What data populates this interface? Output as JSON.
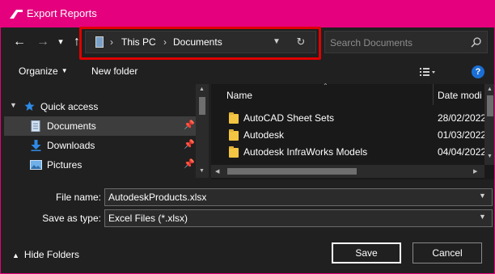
{
  "window": {
    "title": "Export Reports"
  },
  "nav": {
    "back": "←",
    "forward": "→",
    "recent": "▾",
    "up": "↑"
  },
  "address": {
    "crumbs": [
      "This PC",
      "Documents"
    ],
    "separator": "›"
  },
  "search": {
    "placeholder": "Search Documents"
  },
  "toolbar": {
    "organize": "Organize",
    "new_folder": "New folder"
  },
  "sidebar": {
    "items": [
      {
        "label": "Quick access",
        "icon": "star-icon"
      },
      {
        "label": "Documents",
        "icon": "document-icon",
        "pinned": true,
        "selected": true
      },
      {
        "label": "Downloads",
        "icon": "download-arrow-icon",
        "pinned": true
      },
      {
        "label": "Pictures",
        "icon": "picture-icon",
        "pinned": true
      }
    ]
  },
  "files": {
    "columns": {
      "name": "Name",
      "date": "Date modi"
    },
    "rows": [
      {
        "name": "AutoCAD Sheet Sets",
        "date": "28/02/2022"
      },
      {
        "name": "Autodesk",
        "date": "01/03/2022"
      },
      {
        "name": "Autodesk InfraWorks Models",
        "date": "04/04/2022"
      }
    ]
  },
  "form": {
    "file_name_label": "File name:",
    "file_name_value": "AutodeskProducts.xlsx",
    "save_type_label": "Save as type:",
    "save_type_value": "Excel Files (*.xlsx)"
  },
  "footer": {
    "hide_folders": "Hide Folders",
    "save": "Save",
    "cancel": "Cancel"
  },
  "colors": {
    "accent": "#e5007e",
    "highlight": "#e00000"
  }
}
